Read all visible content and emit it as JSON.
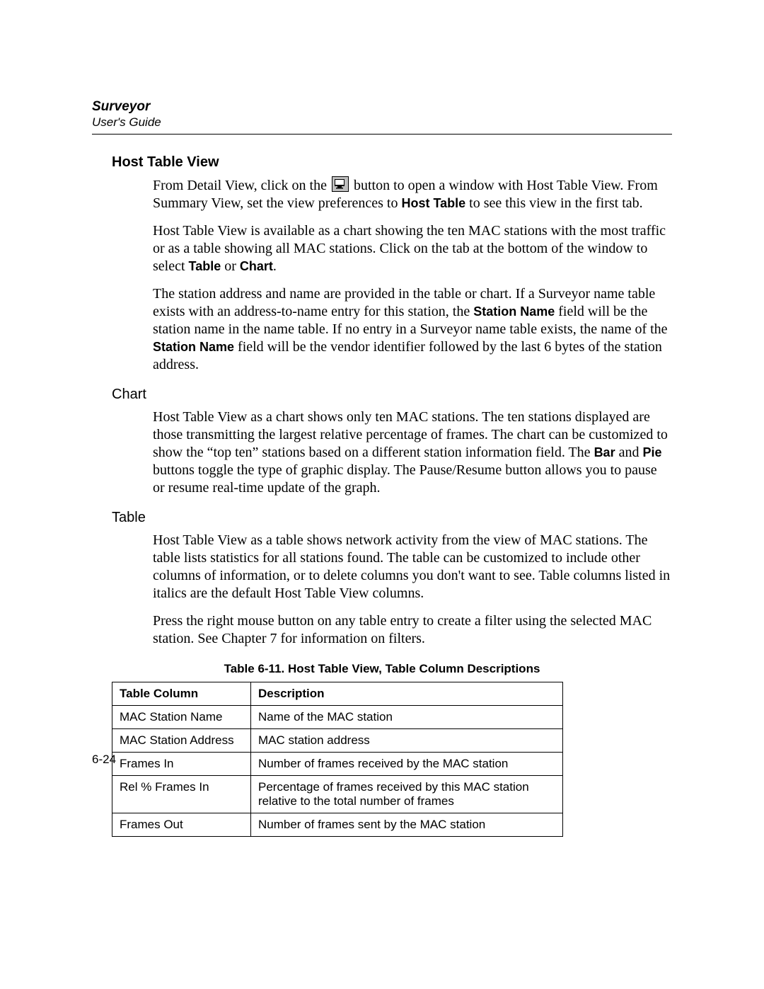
{
  "header": {
    "product": "Surveyor",
    "doc": "User's Guide"
  },
  "section": {
    "title": "Host Table View",
    "p1a": "From Detail View, click on the ",
    "p1b": " button to open a window with Host Table View. From Summary View, set the view preferences to ",
    "p1_bold1": "Host Table",
    "p1c": " to see this view in the first tab.",
    "p2a": "Host Table View is available as a chart showing the ten MAC stations with the most traffic or as a table showing all MAC stations. Click on the tab at the bottom of the window to select ",
    "p2_bold1": "Table",
    "p2b": " or ",
    "p2_bold2": "Chart",
    "p2c": ".",
    "p3a": "The station address and name are provided in the table or chart. If a Surveyor name table exists with an address-to-name entry for this station, the ",
    "p3_bold1": "Station Name",
    "p3b": " field will be the station name in the name table. If no entry in a Surveyor name table exists, the name of the ",
    "p3_bold2": "Station Name",
    "p3c": " field will be the vendor identifier followed by the last 6 bytes of the station address."
  },
  "chart": {
    "heading": "Chart",
    "p1a": "Host Table View as a chart shows only ten MAC stations. The ten stations displayed are those transmitting the largest relative percentage of frames. The chart can be customized to show the “top ten” stations based on a different station information field. The ",
    "p1_bold1": "Bar",
    "p1b": " and ",
    "p1_bold2": "Pie",
    "p1c": " buttons toggle the type of graphic display. The Pause/Resume button allows you to pause or resume real-time update of the graph."
  },
  "table_section": {
    "heading": "Table",
    "p1": "Host Table View as a table shows network activity from the view of MAC stations. The table lists statistics for all stations found. The table can be customized to include other columns of information, or to delete columns you don't want to see. Table columns listed in italics are the default Host Table View columns.",
    "p2": "Press the right mouse button on any table entry to create a filter using the selected MAC station. See Chapter 7 for information on filters."
  },
  "table": {
    "caption": "Table 6-11. Host Table View, Table Column Descriptions",
    "headers": {
      "col1": "Table Column",
      "col2": "Description"
    },
    "rows": [
      {
        "c1": "MAC Station Name",
        "c2": "Name of the MAC station"
      },
      {
        "c1": "MAC Station Address",
        "c2": "MAC station address"
      },
      {
        "c1": "Frames In",
        "c2": "Number of frames received by the MAC station"
      },
      {
        "c1": "Rel % Frames In",
        "c2": "Percentage of frames received by this MAC station relative to the total number of frames"
      },
      {
        "c1": "Frames Out",
        "c2": "Number of frames sent by the MAC station"
      }
    ]
  },
  "page_number": "6-24"
}
